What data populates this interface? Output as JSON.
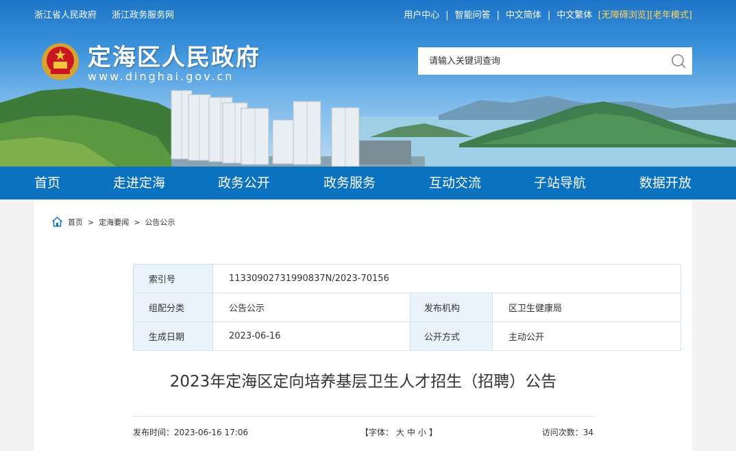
{
  "header": {
    "top_links": [
      "浙江省人民政府",
      "浙江政务服务网"
    ],
    "utility": {
      "user_center": "用户中心",
      "qa": "智能问答",
      "simplified": "中文简体",
      "traditional": "中文繁体",
      "accessible": "[无障碍浏览]",
      "elder": "[老年模式]"
    },
    "site_title": "定海区人民政府",
    "site_url": "www.dinghai.gov.cn",
    "search": {
      "placeholder": "请输入关键词查询",
      "icon": "search-icon"
    }
  },
  "nav": [
    "首页",
    "走进定海",
    "政务公开",
    "政务服务",
    "互动交流",
    "子站导航",
    "数据开放"
  ],
  "breadcrumb": [
    "首页",
    "定海要闻",
    "公告公示"
  ],
  "meta": {
    "index_label": "索引号",
    "index_value": "11330902731990837N/2023-70156",
    "category_label": "组配分类",
    "category_value": "公告公示",
    "org_label": "发布机构",
    "org_value": "区卫生健康局",
    "date_label": "生成日期",
    "date_value": "2023-06-16",
    "mode_label": "公开方式",
    "mode_value": "主动公开"
  },
  "article": {
    "title": "2023年定海区定向培养基层卫生人才招生（招聘）公告",
    "publish": "发布时间：2023-06-16 17:06",
    "font_prefix": "【字体：",
    "font_large": "大",
    "font_medium": "中",
    "font_small": "小",
    "font_suffix": "】",
    "visits": "访问次数：34"
  },
  "colors": {
    "nav": "#0b72bf",
    "meta_label_bg": "#eaf3fb",
    "accent_yellow": "#ffd45a"
  }
}
